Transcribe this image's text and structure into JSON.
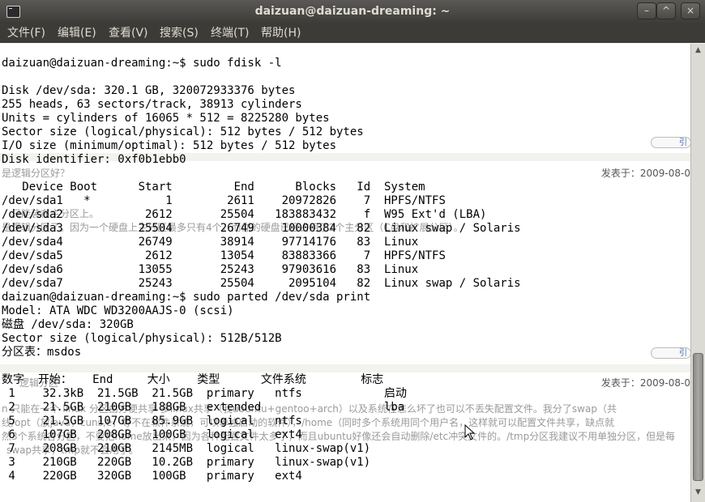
{
  "window": {
    "title": "daizuan@daizuan-dreaming: ~",
    "buttons": {
      "minimize": "–",
      "maximize": "^",
      "close": "×"
    }
  },
  "menu": [
    {
      "label": "文件(F)"
    },
    {
      "label": "编辑(E)"
    },
    {
      "label": "查看(V)"
    },
    {
      "label": "搜索(S)"
    },
    {
      "label": "终端(T)"
    },
    {
      "label": "帮助(H)"
    }
  ],
  "terminal": {
    "lines": [
      "",
      "daizuan@daizuan-dreaming:~$ sudo fdisk -l",
      "",
      "Disk /dev/sda: 320.1 GB, 320072933376 bytes",
      "255 heads, 63 sectors/track, 38913 cylinders",
      "Units = cylinders of 16065 * 512 = 8225280 bytes",
      "Sector size (logical/physical): 512 bytes / 512 bytes",
      "I/O size (minimum/optimal): 512 bytes / 512 bytes",
      "Disk identifier: 0xf0b1ebb0",
      "",
      "   Device Boot      Start         End      Blocks   Id  System",
      "/dev/sda1   *           1        2611    20972826    7  HPFS/NTFS",
      "/dev/sda2            2612       25504   183883432    f  W95 Ext'd (LBA)",
      "/dev/sda3           25504       26749    10000384   82  Linux swap / Solaris",
      "/dev/sda4           26749       38914    97714176   83  Linux",
      "/dev/sda5            2612       13054    83883366    7  HPFS/NTFS",
      "/dev/sda6           13055       25243    97903616   83  Linux",
      "/dev/sda7           25243       25504     2095104   82  Linux swap / Solaris",
      "daizuan@daizuan-dreaming:~$ sudo parted /dev/sda print",
      "Model: ATA WDC WD3200AAJS-0 (scsi)",
      "磁盘 /dev/sda: 320GB",
      "Sector size (logical/physical): 512B/512B",
      "分区表：msdos",
      "",
      "数字  开始：   End     大小    类型      文件系统        标志",
      " 1    32.3kB  21.5GB  21.5GB  primary   ntfs            启动",
      " 2    21.5GB  210GB   188GB   extended                  lba",
      " 5    21.5GB  107GB   85.9GB  logical   ntfs",
      " 6    107GB   208GB   100GB   logical   ext4",
      " 7    208GB   210GB   2145MB  logical   linux-swap(v1)",
      " 3    210GB   220GB   10.2GB  primary   linux-swap(v1)",
      " 4    220GB   320GB   100GB   primary   ext4"
    ],
    "overlay": {
      "question1": "是逻辑分区好？",
      "date1": "发表于：2009-08-0",
      "text1": "只能装在主分区上。",
      "text2": "是逻辑分区了。因为一个硬盘上主分区最多只有4个，而你的硬盘已经占用了2个主分区（C盘和扩展分区）。",
      "question2": "逻辑分区",
      "date2": "发表于：2009-08-0",
      "text3": "n 只能在一个 linux 分区由方便共享 多linux共享（我ubuntu+gentoo+arch）以及系统在怎么坏了也可以不丢失配置文件。我分了swap（共",
      "text4": "线/opt（放java，cuns,e，等不在软件系统，可以单独启动的软件），/home（同时多个系统用同个用户名，这样就可以配置文件共享，缺点就",
      "text5": "然3个系统各分区，不要把home放出来，因为各种配置文件太多了，而且ubuntu好像还会自动删除/etc冲突文件的。/tmp分区我建议不用单独分区，但是每",
      "text6": "swap共享，tmp就不会用了。",
      "reply_label": "引"
    }
  }
}
